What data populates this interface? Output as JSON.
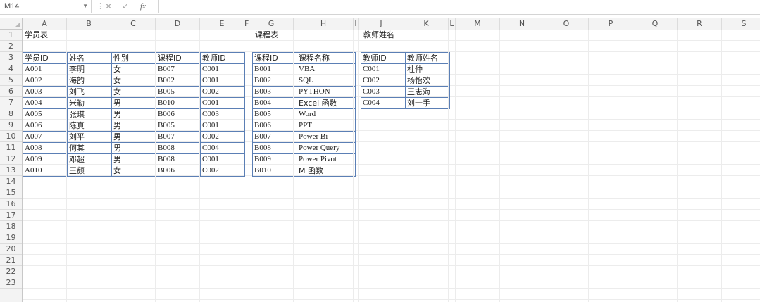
{
  "formula_bar": {
    "name_box": "M14",
    "fx": "fx"
  },
  "columns": [
    "A",
    "B",
    "C",
    "D",
    "E",
    "F",
    "G",
    "H",
    "I",
    "J",
    "K",
    "L",
    "M",
    "N",
    "O",
    "P",
    "Q",
    "R",
    "S"
  ],
  "rows": [
    "1",
    "2",
    "3",
    "4",
    "5",
    "6",
    "7",
    "8",
    "9",
    "10",
    "11",
    "12",
    "13",
    "14",
    "15",
    "16",
    "17",
    "18",
    "19",
    "20",
    "21",
    "22",
    "23"
  ],
  "titles": {
    "students": "学员表",
    "courses": "课程表",
    "teachers": "教师姓名"
  },
  "students": {
    "headers": [
      "学员ID",
      "姓名",
      "性别",
      "课程ID",
      "教师ID"
    ],
    "rows": [
      [
        "A001",
        "李明",
        "女",
        "B007",
        "C001"
      ],
      [
        "A002",
        "海韵",
        "女",
        "B002",
        "C001"
      ],
      [
        "A003",
        "刘飞",
        "女",
        "B005",
        "C002"
      ],
      [
        "A004",
        "米勒",
        "男",
        "B010",
        "C001"
      ],
      [
        "A005",
        "张琪",
        "男",
        "B006",
        "C003"
      ],
      [
        "A006",
        "陈真",
        "男",
        "B005",
        "C001"
      ],
      [
        "A007",
        "刘平",
        "男",
        "B007",
        "C002"
      ],
      [
        "A008",
        "何其",
        "男",
        "B008",
        "C004"
      ],
      [
        "A009",
        "邓超",
        "男",
        "B008",
        "C001"
      ],
      [
        "A010",
        "王颜",
        "女",
        "B006",
        "C002"
      ]
    ]
  },
  "courses": {
    "headers": [
      "课程ID",
      "课程名称"
    ],
    "rows": [
      [
        "B001",
        "VBA"
      ],
      [
        "B002",
        "SQL"
      ],
      [
        "B003",
        "PYTHON"
      ],
      [
        "B004",
        "Excel 函数"
      ],
      [
        "B005",
        "Word"
      ],
      [
        "B006",
        "PPT"
      ],
      [
        "B007",
        "Power Bi"
      ],
      [
        "B008",
        "Power Query"
      ],
      [
        "B009",
        "Power Pivot"
      ],
      [
        "B010",
        "M 函数"
      ]
    ]
  },
  "teachers": {
    "headers": [
      "教师ID",
      "教师姓名"
    ],
    "rows": [
      [
        "C001",
        "杜仲"
      ],
      [
        "C002",
        "杨怡欢"
      ],
      [
        "C003",
        "王志海"
      ],
      [
        "C004",
        "刘一手"
      ]
    ]
  }
}
